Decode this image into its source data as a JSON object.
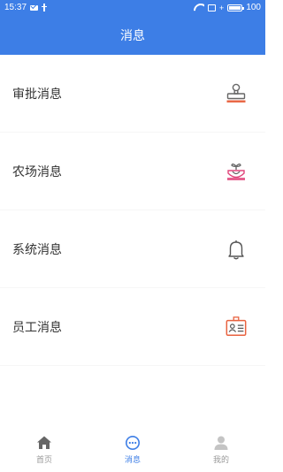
{
  "status_bar": {
    "time": "15:37",
    "battery": "100"
  },
  "header": {
    "title": "消息"
  },
  "messages": [
    {
      "label": "审批消息",
      "icon": "stamp-icon"
    },
    {
      "label": "农场消息",
      "icon": "sprout-pot-icon"
    },
    {
      "label": "系统消息",
      "icon": "bell-icon"
    },
    {
      "label": "员工消息",
      "icon": "id-card-icon"
    }
  ],
  "tabs": [
    {
      "label": "首页",
      "icon": "home-icon",
      "active": false
    },
    {
      "label": "消息",
      "icon": "chat-icon",
      "active": true
    },
    {
      "label": "我的",
      "icon": "user-icon",
      "active": false
    }
  ],
  "colors": {
    "primary": "#3d7ee6",
    "accent_red": "#e8623f",
    "accent_pink": "#e0457b",
    "inactive": "#999999"
  }
}
